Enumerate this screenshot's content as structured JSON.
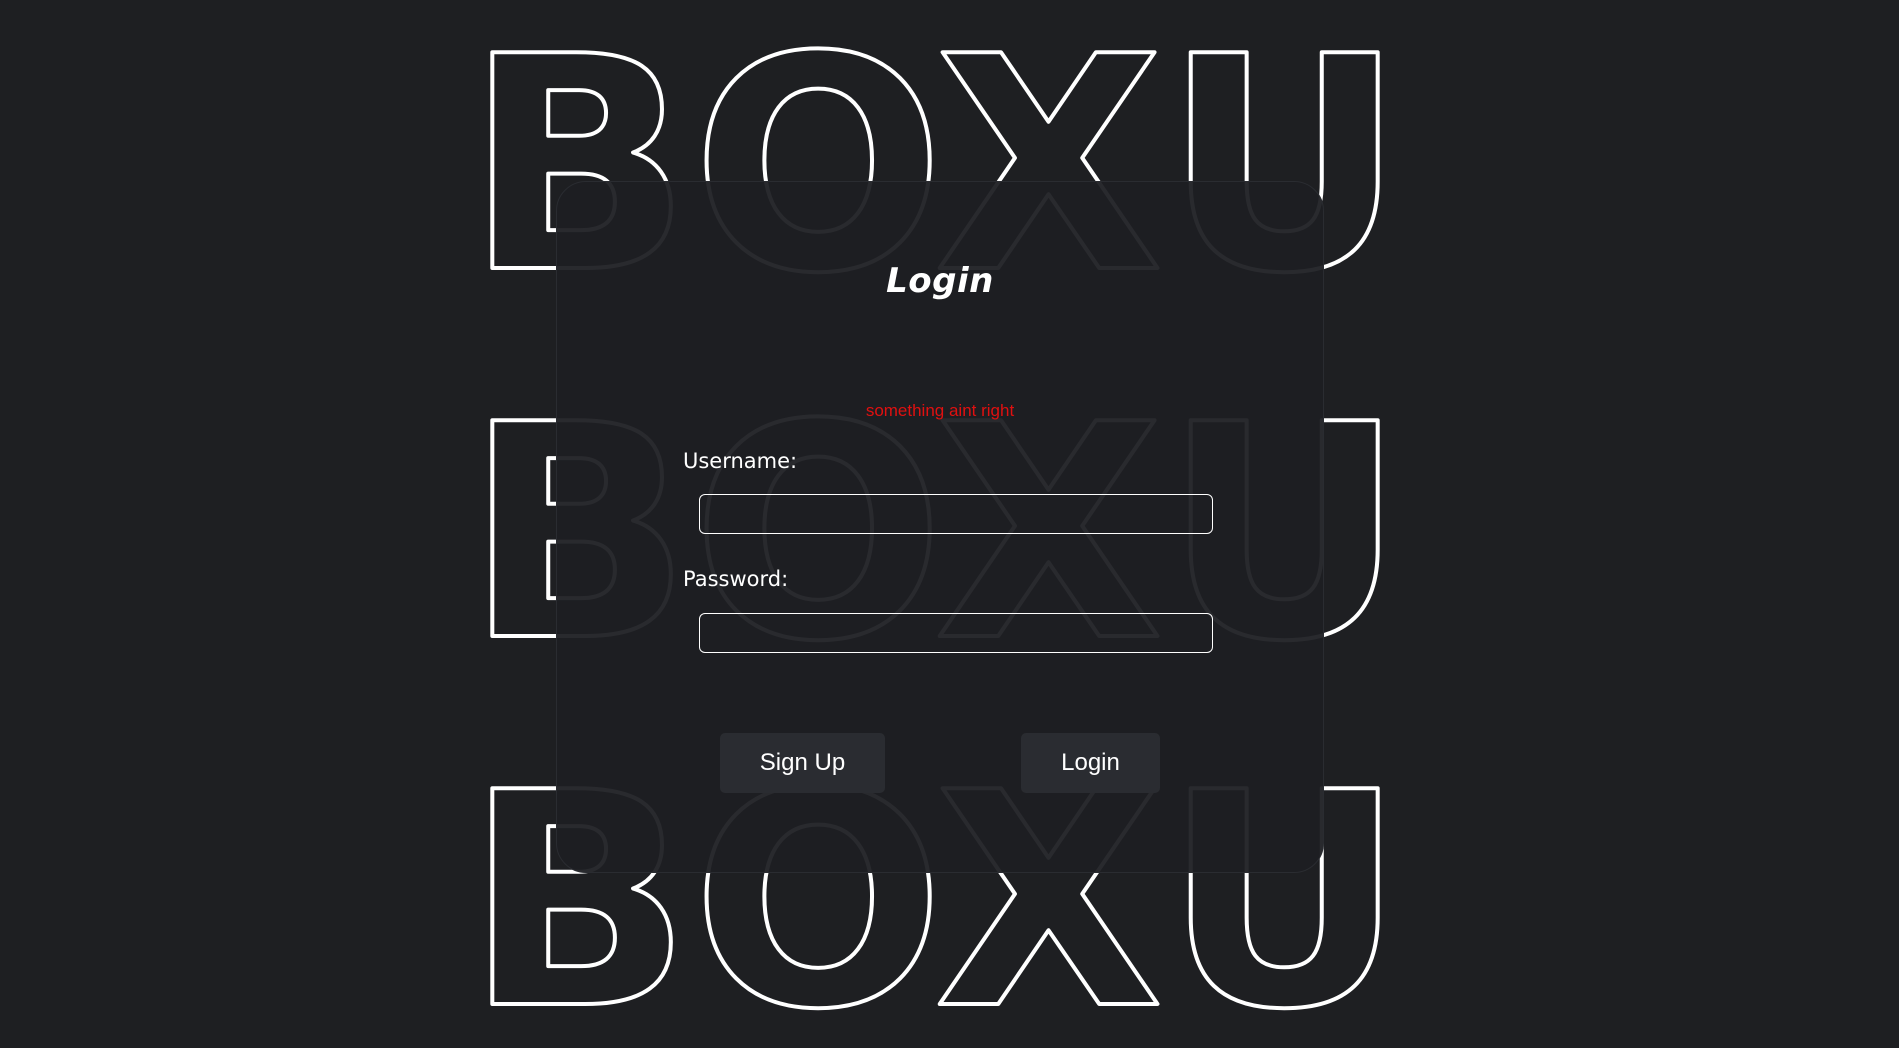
{
  "background": {
    "logo_rows": [
      "BOXU",
      "BOXU",
      "BOXU"
    ]
  },
  "login_card": {
    "title": "Login",
    "error_message": "something aint right",
    "username_label": "Username:",
    "username_value": "",
    "password_label": "Password:",
    "password_value": "",
    "signup_button": "Sign Up",
    "login_button": "Login"
  },
  "colors": {
    "background": "#1e1f22",
    "card": "#1e1f23",
    "button": "#2a2c31",
    "error": "#e01010",
    "outline": "#ffffff"
  }
}
